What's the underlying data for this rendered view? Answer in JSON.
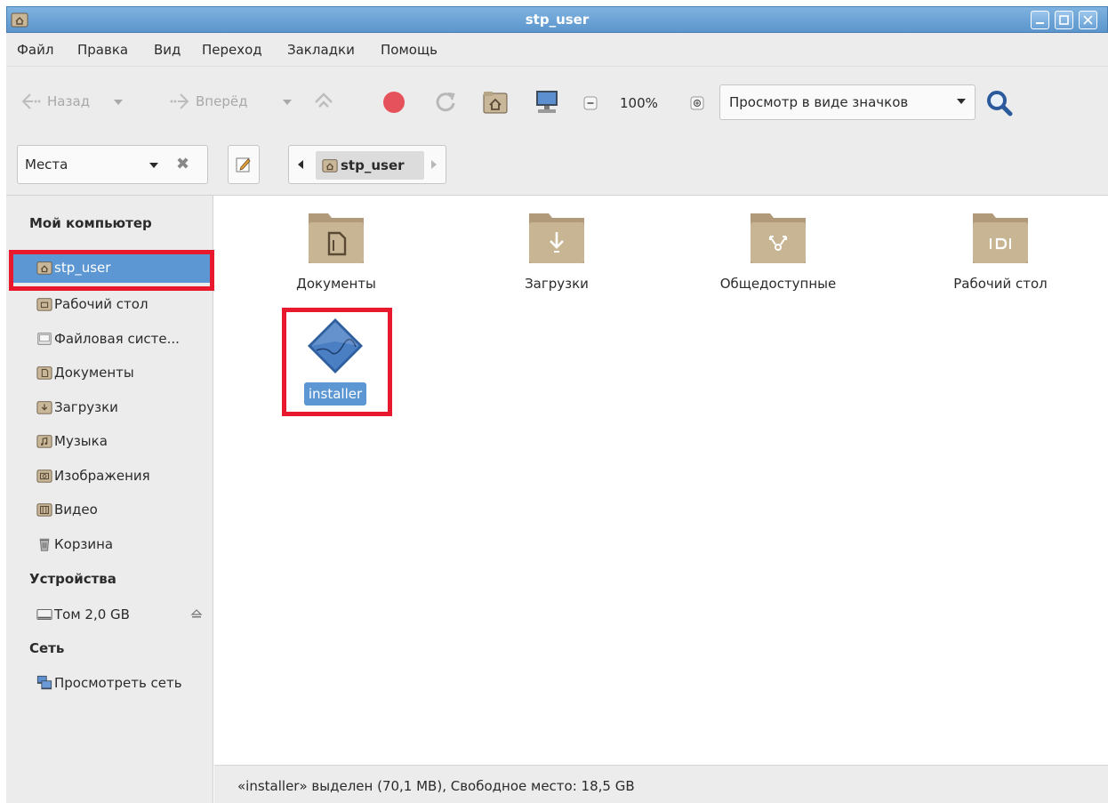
{
  "window": {
    "title": "stp_user"
  },
  "menu": [
    "Файл",
    "Правка",
    "Вид",
    "Переход",
    "Закладки",
    "Помощь"
  ],
  "toolbar": {
    "back_label": "Назад",
    "forward_label": "Вперёд",
    "zoom_level": "100%",
    "view_mode": "Просмотр в виде значков"
  },
  "location": {
    "places_label": "Места",
    "crumb": "stp_user"
  },
  "sidebar": {
    "sections": {
      "computer": "Мой компьютер",
      "devices": "Устройства",
      "network": "Сеть"
    },
    "computer_items": [
      {
        "label": "stp_user",
        "icon": "home-folder-icon"
      },
      {
        "label": "Рабочий стол",
        "icon": "desktop-folder-icon"
      },
      {
        "label": "Файловая систе...",
        "icon": "filesystem-icon"
      },
      {
        "label": "Документы",
        "icon": "documents-folder-icon"
      },
      {
        "label": "Загрузки",
        "icon": "downloads-folder-icon"
      },
      {
        "label": "Музыка",
        "icon": "music-folder-icon"
      },
      {
        "label": "Изображения",
        "icon": "pictures-folder-icon"
      },
      {
        "label": "Видео",
        "icon": "videos-folder-icon"
      },
      {
        "label": "Корзина",
        "icon": "trash-icon"
      }
    ],
    "device_items": [
      {
        "label": "Том 2,0 GB",
        "icon": "drive-icon"
      }
    ],
    "network_items": [
      {
        "label": "Просмотреть сеть",
        "icon": "network-icon"
      }
    ]
  },
  "files": [
    {
      "label": "Документы",
      "icon": "documents-folder-icon"
    },
    {
      "label": "Загрузки",
      "icon": "downloads-folder-icon"
    },
    {
      "label": "Общедоступные",
      "icon": "public-folder-icon"
    },
    {
      "label": "Рабочий стол",
      "icon": "desktop-folder-icon"
    },
    {
      "label": "installer",
      "icon": "executable-file-icon",
      "selected": true
    }
  ],
  "status": "«installer» выделен (70,1 MB), Свободное место: 18,5 GB",
  "colors": {
    "selection": "#5c97d3",
    "titlebar": "#6aa1d6",
    "highlight_box": "#e8192c"
  }
}
